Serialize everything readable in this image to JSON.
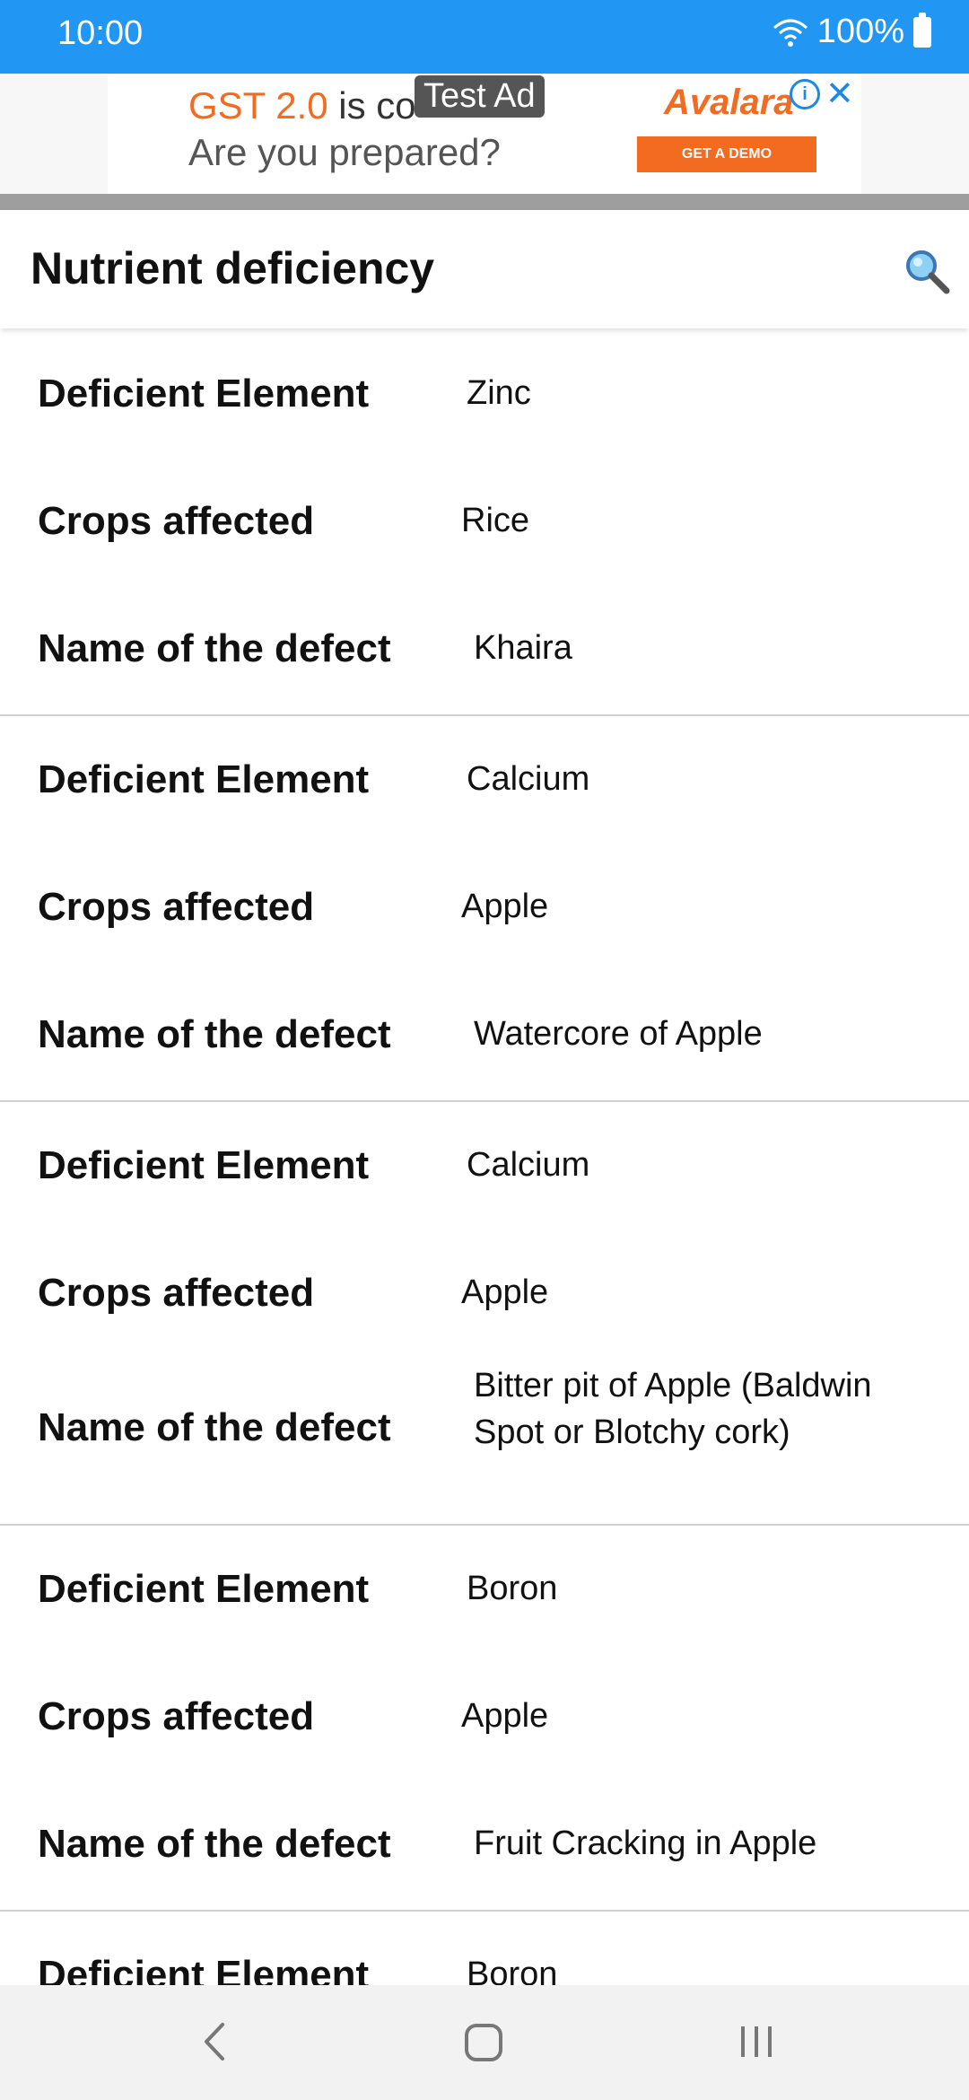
{
  "status_bar": {
    "time": "10:00",
    "battery": "100%"
  },
  "ad": {
    "label": "Test Ad",
    "line1_highlight": "GST 2.0",
    "line1_rest": " is co",
    "line2": "Are you prepared?",
    "brand": "Avalara",
    "cta": "GET A DEMO",
    "info_icon": "info-icon",
    "close_icon": "close-icon"
  },
  "app_bar": {
    "title": "Nutrient deficiency",
    "search_icon": "search-icon"
  },
  "labels": {
    "element": "Deficient Element",
    "crops": "Crops affected",
    "defect": "Name of the defect"
  },
  "items": [
    {
      "element": "Zinc",
      "crops": "Rice",
      "defect": "Khaira"
    },
    {
      "element": "Calcium",
      "crops": "Apple",
      "defect": "Watercore of Apple"
    },
    {
      "element": "Calcium",
      "crops": "Apple",
      "defect": "Bitter pit of Apple (Baldwin Spot or Blotchy cork)"
    },
    {
      "element": "Boron",
      "crops": "Apple",
      "defect": "Fruit Cracking in Apple"
    },
    {
      "element": "Boron"
    }
  ],
  "nav": {
    "back_icon": "back-icon",
    "home_icon": "home-icon",
    "recents_icon": "recents-icon"
  },
  "colors": {
    "status_bar": "#2196F3",
    "ad_orange": "#F26B21",
    "ad_blue": "#1E88E5"
  }
}
